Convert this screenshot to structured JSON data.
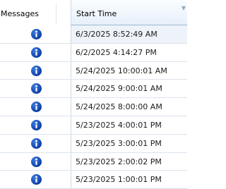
{
  "header": {
    "messages_label": "Messages",
    "start_time_label": "Start Time",
    "sort_icon": "chevron-down-icon"
  },
  "rows": [
    {
      "icon": "info-icon",
      "start_time": "6/3/2025 8:52:49 AM"
    },
    {
      "icon": "info-icon",
      "start_time": "6/2/2025 4:14:27 PM"
    },
    {
      "icon": "info-icon",
      "start_time": "5/24/2025 10:00:01 AM"
    },
    {
      "icon": "info-icon",
      "start_time": "5/24/2025 9:00:01 AM"
    },
    {
      "icon": "info-icon",
      "start_time": "5/24/2025 8:00:00 AM"
    },
    {
      "icon": "info-icon",
      "start_time": "5/23/2025 4:00:01 PM"
    },
    {
      "icon": "info-icon",
      "start_time": "5/23/2025 3:00:01 PM"
    },
    {
      "icon": "info-icon",
      "start_time": "5/23/2025 2:00:02 PM"
    },
    {
      "icon": "info-icon",
      "start_time": "5/23/2025 1:00:01 PM"
    }
  ],
  "colors": {
    "info_icon": "#0d3fa6",
    "header_highlight": "#e6f0fa",
    "selected_row": "#eef3f9"
  }
}
